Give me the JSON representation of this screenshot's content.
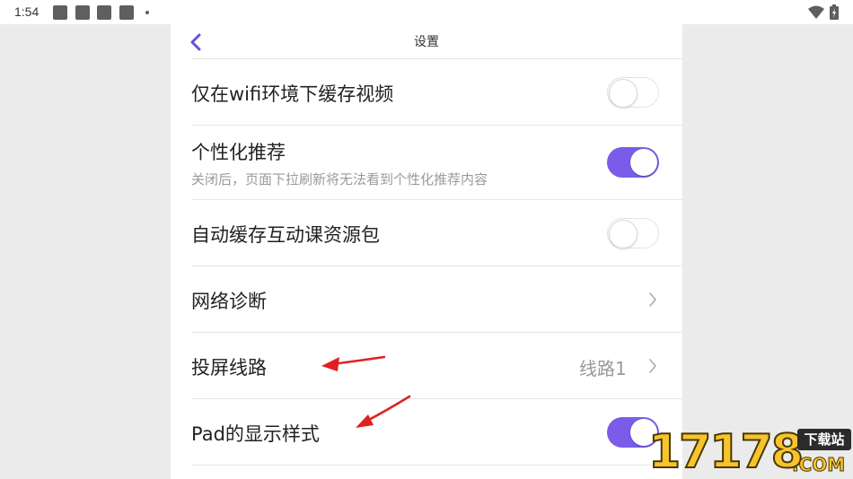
{
  "status_bar": {
    "time": "1:54",
    "notification_icons": [
      "app-notification-icon",
      "app-notification-icon",
      "app-notification-icon",
      "app-notification-icon"
    ],
    "wifi_icon": "wifi-icon",
    "battery_icon": "battery-icon"
  },
  "header": {
    "back_icon": "chevron-left-icon",
    "title": "设置"
  },
  "settings": {
    "wifi_only_cache": {
      "label": "仅在wifi环境下缓存视频",
      "enabled": false
    },
    "personalized": {
      "label": "个性化推荐",
      "description": "关闭后，页面下拉刷新将无法看到个性化推荐内容",
      "enabled": true
    },
    "auto_cache": {
      "label": "自动缓存互动课资源包",
      "enabled": false
    },
    "network": {
      "label": "网络诊断",
      "icon": "chevron-right-icon"
    },
    "cast_line": {
      "label": "投屏线路",
      "value": "线路1",
      "icon": "chevron-right-icon"
    },
    "pad_style": {
      "label": "Pad的显示样式",
      "enabled": true
    }
  },
  "colors": {
    "accent": "#7a5ce9",
    "annotation_arrow": "#e02020",
    "watermark": "#f7c32e"
  },
  "watermark": {
    "number": "17178",
    "badge": "下载站",
    "domain": ".COM"
  }
}
